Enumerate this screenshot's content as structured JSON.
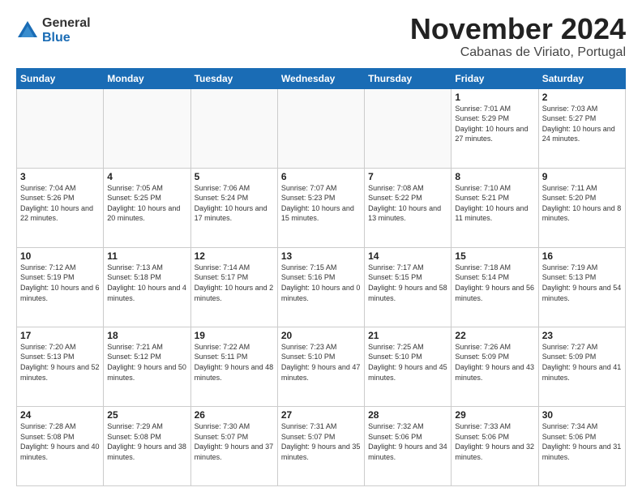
{
  "logo": {
    "general": "General",
    "blue": "Blue"
  },
  "title": "November 2024",
  "location": "Cabanas de Viriato, Portugal",
  "weekdays": [
    "Sunday",
    "Monday",
    "Tuesday",
    "Wednesday",
    "Thursday",
    "Friday",
    "Saturday"
  ],
  "weeks": [
    [
      {
        "day": "",
        "detail": ""
      },
      {
        "day": "",
        "detail": ""
      },
      {
        "day": "",
        "detail": ""
      },
      {
        "day": "",
        "detail": ""
      },
      {
        "day": "",
        "detail": ""
      },
      {
        "day": "1",
        "detail": "Sunrise: 7:01 AM\nSunset: 5:29 PM\nDaylight: 10 hours\nand 27 minutes."
      },
      {
        "day": "2",
        "detail": "Sunrise: 7:03 AM\nSunset: 5:27 PM\nDaylight: 10 hours\nand 24 minutes."
      }
    ],
    [
      {
        "day": "3",
        "detail": "Sunrise: 7:04 AM\nSunset: 5:26 PM\nDaylight: 10 hours\nand 22 minutes."
      },
      {
        "day": "4",
        "detail": "Sunrise: 7:05 AM\nSunset: 5:25 PM\nDaylight: 10 hours\nand 20 minutes."
      },
      {
        "day": "5",
        "detail": "Sunrise: 7:06 AM\nSunset: 5:24 PM\nDaylight: 10 hours\nand 17 minutes."
      },
      {
        "day": "6",
        "detail": "Sunrise: 7:07 AM\nSunset: 5:23 PM\nDaylight: 10 hours\nand 15 minutes."
      },
      {
        "day": "7",
        "detail": "Sunrise: 7:08 AM\nSunset: 5:22 PM\nDaylight: 10 hours\nand 13 minutes."
      },
      {
        "day": "8",
        "detail": "Sunrise: 7:10 AM\nSunset: 5:21 PM\nDaylight: 10 hours\nand 11 minutes."
      },
      {
        "day": "9",
        "detail": "Sunrise: 7:11 AM\nSunset: 5:20 PM\nDaylight: 10 hours\nand 8 minutes."
      }
    ],
    [
      {
        "day": "10",
        "detail": "Sunrise: 7:12 AM\nSunset: 5:19 PM\nDaylight: 10 hours\nand 6 minutes."
      },
      {
        "day": "11",
        "detail": "Sunrise: 7:13 AM\nSunset: 5:18 PM\nDaylight: 10 hours\nand 4 minutes."
      },
      {
        "day": "12",
        "detail": "Sunrise: 7:14 AM\nSunset: 5:17 PM\nDaylight: 10 hours\nand 2 minutes."
      },
      {
        "day": "13",
        "detail": "Sunrise: 7:15 AM\nSunset: 5:16 PM\nDaylight: 10 hours\nand 0 minutes."
      },
      {
        "day": "14",
        "detail": "Sunrise: 7:17 AM\nSunset: 5:15 PM\nDaylight: 9 hours\nand 58 minutes."
      },
      {
        "day": "15",
        "detail": "Sunrise: 7:18 AM\nSunset: 5:14 PM\nDaylight: 9 hours\nand 56 minutes."
      },
      {
        "day": "16",
        "detail": "Sunrise: 7:19 AM\nSunset: 5:13 PM\nDaylight: 9 hours\nand 54 minutes."
      }
    ],
    [
      {
        "day": "17",
        "detail": "Sunrise: 7:20 AM\nSunset: 5:13 PM\nDaylight: 9 hours\nand 52 minutes."
      },
      {
        "day": "18",
        "detail": "Sunrise: 7:21 AM\nSunset: 5:12 PM\nDaylight: 9 hours\nand 50 minutes."
      },
      {
        "day": "19",
        "detail": "Sunrise: 7:22 AM\nSunset: 5:11 PM\nDaylight: 9 hours\nand 48 minutes."
      },
      {
        "day": "20",
        "detail": "Sunrise: 7:23 AM\nSunset: 5:10 PM\nDaylight: 9 hours\nand 47 minutes."
      },
      {
        "day": "21",
        "detail": "Sunrise: 7:25 AM\nSunset: 5:10 PM\nDaylight: 9 hours\nand 45 minutes."
      },
      {
        "day": "22",
        "detail": "Sunrise: 7:26 AM\nSunset: 5:09 PM\nDaylight: 9 hours\nand 43 minutes."
      },
      {
        "day": "23",
        "detail": "Sunrise: 7:27 AM\nSunset: 5:09 PM\nDaylight: 9 hours\nand 41 minutes."
      }
    ],
    [
      {
        "day": "24",
        "detail": "Sunrise: 7:28 AM\nSunset: 5:08 PM\nDaylight: 9 hours\nand 40 minutes."
      },
      {
        "day": "25",
        "detail": "Sunrise: 7:29 AM\nSunset: 5:08 PM\nDaylight: 9 hours\nand 38 minutes."
      },
      {
        "day": "26",
        "detail": "Sunrise: 7:30 AM\nSunset: 5:07 PM\nDaylight: 9 hours\nand 37 minutes."
      },
      {
        "day": "27",
        "detail": "Sunrise: 7:31 AM\nSunset: 5:07 PM\nDaylight: 9 hours\nand 35 minutes."
      },
      {
        "day": "28",
        "detail": "Sunrise: 7:32 AM\nSunset: 5:06 PM\nDaylight: 9 hours\nand 34 minutes."
      },
      {
        "day": "29",
        "detail": "Sunrise: 7:33 AM\nSunset: 5:06 PM\nDaylight: 9 hours\nand 32 minutes."
      },
      {
        "day": "30",
        "detail": "Sunrise: 7:34 AM\nSunset: 5:06 PM\nDaylight: 9 hours\nand 31 minutes."
      }
    ]
  ]
}
